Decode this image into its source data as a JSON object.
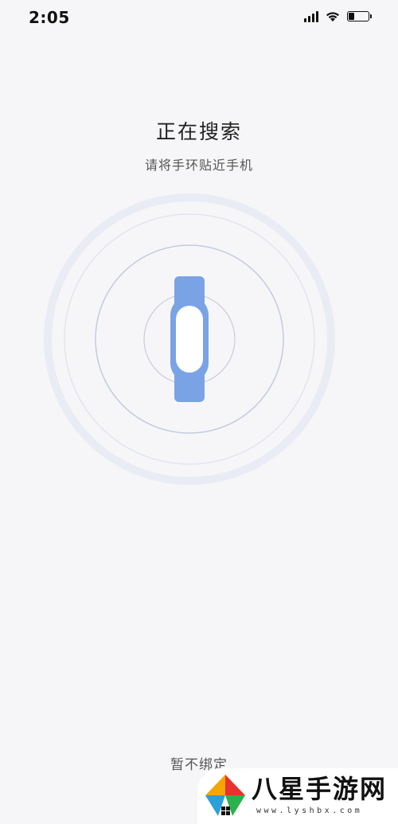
{
  "status_bar": {
    "time": "2:05",
    "battery_level": 0.3,
    "icons": [
      "signal-icon",
      "wifi-icon",
      "battery-icon"
    ]
  },
  "search": {
    "title": "正在搜索",
    "subtitle": "请将手环贴近手机"
  },
  "device": {
    "icon": "band-icon",
    "color": "#7aa3e5"
  },
  "footer": {
    "skip_label": "暂不绑定"
  },
  "watermark": {
    "name": "八星手游网",
    "url": "www.lyshbx.com"
  }
}
